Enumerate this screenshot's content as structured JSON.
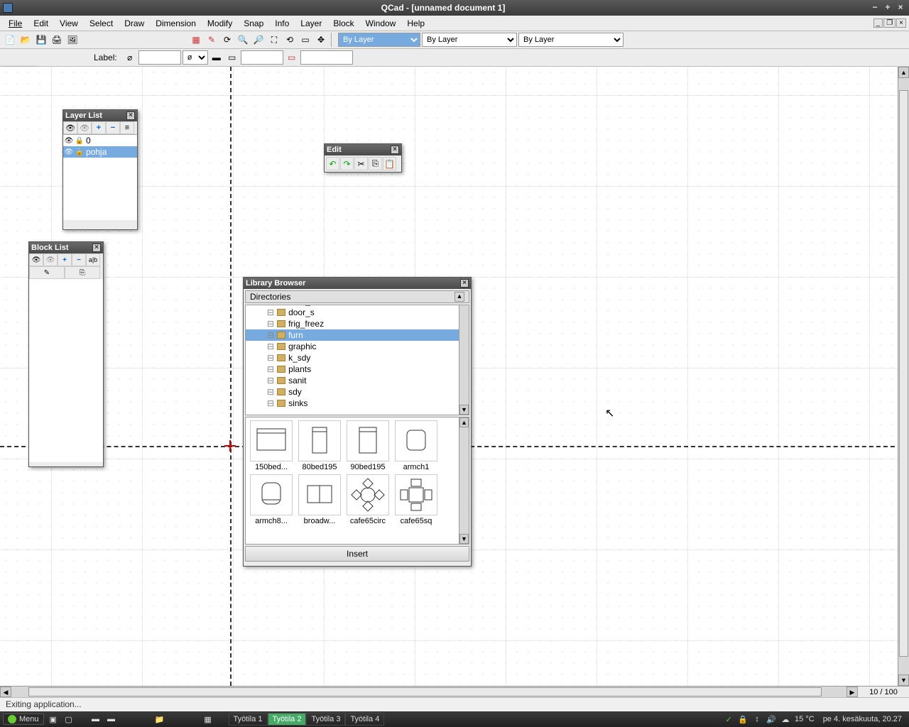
{
  "window": {
    "title": "QCad - [unnamed document 1]"
  },
  "menu": {
    "file": "File",
    "edit": "Edit",
    "view": "View",
    "select": "Select",
    "draw": "Draw",
    "dimension": "Dimension",
    "modify": "Modify",
    "snap": "Snap",
    "info": "Info",
    "layer": "Layer",
    "block": "Block",
    "window": "Window",
    "help": "Help"
  },
  "toolbar2": {
    "label_label": "Label:",
    "diameter_value": "ø"
  },
  "props": {
    "color": "By Layer",
    "linetype": "By Layer",
    "lineweight": "By Layer"
  },
  "layer_panel": {
    "title": "Layer List",
    "layers": [
      {
        "name": "0",
        "visible": true,
        "locked": true,
        "selected": false
      },
      {
        "name": "pohja",
        "visible": true,
        "locked": true,
        "selected": true
      }
    ]
  },
  "block_panel": {
    "title": "Block List"
  },
  "edit_panel": {
    "title": "Edit"
  },
  "library": {
    "title": "Library Browser",
    "dir_header": "Directories",
    "dirs": [
      {
        "name": "door_d",
        "selected": false
      },
      {
        "name": "door_s",
        "selected": false
      },
      {
        "name": "frig_freez",
        "selected": false
      },
      {
        "name": "furn",
        "selected": true
      },
      {
        "name": "graphic",
        "selected": false
      },
      {
        "name": "k_sdy",
        "selected": false
      },
      {
        "name": "plants",
        "selected": false
      },
      {
        "name": "sanit",
        "selected": false
      },
      {
        "name": "sdy",
        "selected": false
      },
      {
        "name": "sinks",
        "selected": false
      }
    ],
    "items": [
      "150bed...",
      "80bed195",
      "90bed195",
      "armch1",
      "armch8...",
      "broadw...",
      "cafe65circ",
      "cafe65sq"
    ],
    "insert_label": "Insert"
  },
  "zoom": "10 / 100",
  "status": "Exiting application...",
  "taskbar": {
    "menu": "Menu",
    "workspaces": [
      "Työtila 1",
      "Työtila 2",
      "Työtila 3",
      "Työtila 4"
    ],
    "ws_active": 1,
    "temp": "15 °C",
    "clock": "pe  4. kesäkuuta, 20.27"
  }
}
